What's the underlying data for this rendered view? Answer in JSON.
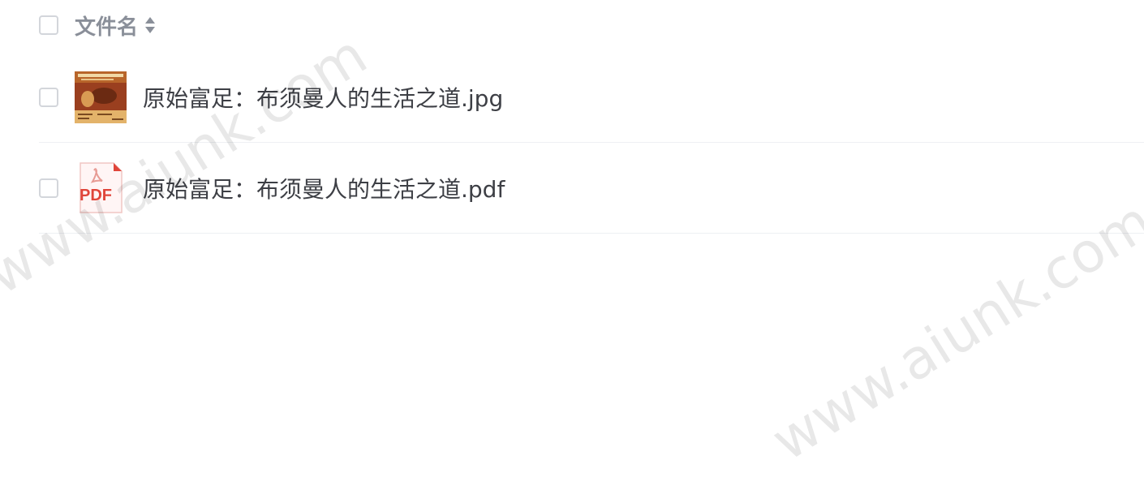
{
  "header": {
    "column_title": "文件名"
  },
  "files": [
    {
      "name": "原始富足：布须曼人的生活之道.jpg",
      "type": "jpg"
    },
    {
      "name": "原始富足：布须曼人的生活之道.pdf",
      "type": "pdf"
    }
  ],
  "thumbnails": {
    "pdf_label": "PDF"
  },
  "watermark": {
    "text": "www.aiunk.com"
  },
  "colors": {
    "pdf_red": "#e0453a",
    "checkbox_border": "#d3d6db",
    "header_text": "#8a8f99"
  }
}
